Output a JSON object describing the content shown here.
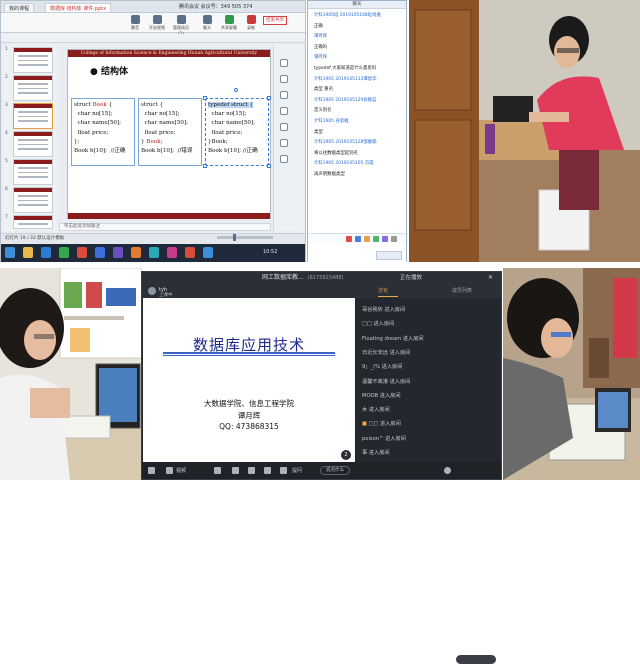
{
  "panel_a": {
    "tabs": [
      "我的课程",
      "数据库 结构体 课件.pptx"
    ],
    "meeting_info": "腾讯会议 会议号：349 505 374",
    "ribbon_buttons": [
      "静音",
      "开启视频",
      "管理成员(1)",
      "聊天",
      "共享屏幕",
      "录制",
      "举手"
    ],
    "record_button": "结束共享",
    "slide": {
      "header": "College of Information Science & Engineering  Hunan Agricultural University",
      "bullet_title": "● 结构体",
      "box1": {
        "line1_a": "struct ",
        "line1_b": "Book",
        "line1_c": " {",
        "l2": "  char no[15];",
        "l3": "  char name[50];",
        "l4": "  float price;",
        "l5": "};",
        "l6": "Book b[10];  //正确"
      },
      "box2": {
        "l1": "struct {",
        "l2": "  char no[15];",
        "l3": "  char name[50];",
        "l4": "  float price;",
        "l5_a": "} ",
        "l5_b": "Book;",
        "l6": "Book b[10];  //错误"
      },
      "box3": {
        "l1": "typedef struct {",
        "l2": "  char no[15];",
        "l3": "  char name[50];",
        "l4": "  float price;",
        "l5": "}Book;",
        "l6": "Book b[10]; //正确"
      }
    },
    "thumb_numbers": [
      "1",
      "2",
      "3",
      "4",
      "5",
      "6",
      "7"
    ],
    "notes_placeholder": "单击此处添加备注",
    "status_text": "幻灯片 19 / 33    默认设计模板",
    "tray_time": "10:52"
  },
  "panel_b": {
    "title": "聊天",
    "lines": [
      {
        "type": "meta",
        "text": "计科1905班 2019105108赵尚嘉"
      },
      {
        "type": "msg",
        "text": "正确"
      },
      {
        "type": "meta",
        "text": "谭月辉"
      },
      {
        "type": "msg",
        "text": "正确吗"
      },
      {
        "type": "meta",
        "text": "谭月辉"
      },
      {
        "type": "msg",
        "text": "typedef 大家知道是什么意思吗"
      },
      {
        "type": "meta",
        "text": "计科1905 2019105113谭恩华"
      },
      {
        "type": "msg",
        "text": "类型 重名"
      },
      {
        "type": "meta",
        "text": "计科1905 2019105129徐静蓝"
      },
      {
        "type": "msg",
        "text": "定义别名"
      },
      {
        "type": "meta",
        "text": "计科1905 谷思雅"
      },
      {
        "type": "msg",
        "text": "类型"
      },
      {
        "type": "meta",
        "text": "计科1905 2019105128邹嘉瑜"
      },
      {
        "type": "msg",
        "text": "将以往数据类型起别名"
      },
      {
        "type": "meta",
        "text": "计科1905 2019105105 冯霞"
      },
      {
        "type": "msg",
        "text": "再声明数据类型"
      }
    ]
  },
  "panel_e": {
    "title": "网工数据库教...",
    "room_number": "(8175923488)",
    "host": "正在播放",
    "teacher_name": "tyh",
    "teacher_status": "上课中",
    "slide_title": "数据库应用技术",
    "slide_lines": [
      "大数据学院、信息工程学院",
      "谭月辉",
      "QQ: 473868315"
    ],
    "page_num": "2",
    "controls": [
      "视频",
      "提问"
    ],
    "ask_label": "说点什么",
    "side_tabs": [
      "讨论",
      "成员列表"
    ],
    "enter_lines": [
      {
        "flag": "",
        "text": "哥谷我依 进入房间"
      },
      {
        "flag": "",
        "text": "□□ 进入房间"
      },
      {
        "flag": "",
        "text": "Floating  dream 进入房间"
      },
      {
        "flag": "",
        "text": "日近长安远 进入房间"
      },
      {
        "flag": "",
        "text": "9」_(% 进入房间"
      },
      {
        "flag": "",
        "text": "温馨不离港 进入房间"
      },
      {
        "flag": "",
        "text": "MOOB 进入房间"
      },
      {
        "flag": "",
        "text": "木 进入房间"
      },
      {
        "flag": "■",
        "text": "□□ 进入房间"
      },
      {
        "flag": "",
        "text": "poison^ 进入房间"
      },
      {
        "flag": "",
        "text": "事 进入房间"
      }
    ]
  }
}
